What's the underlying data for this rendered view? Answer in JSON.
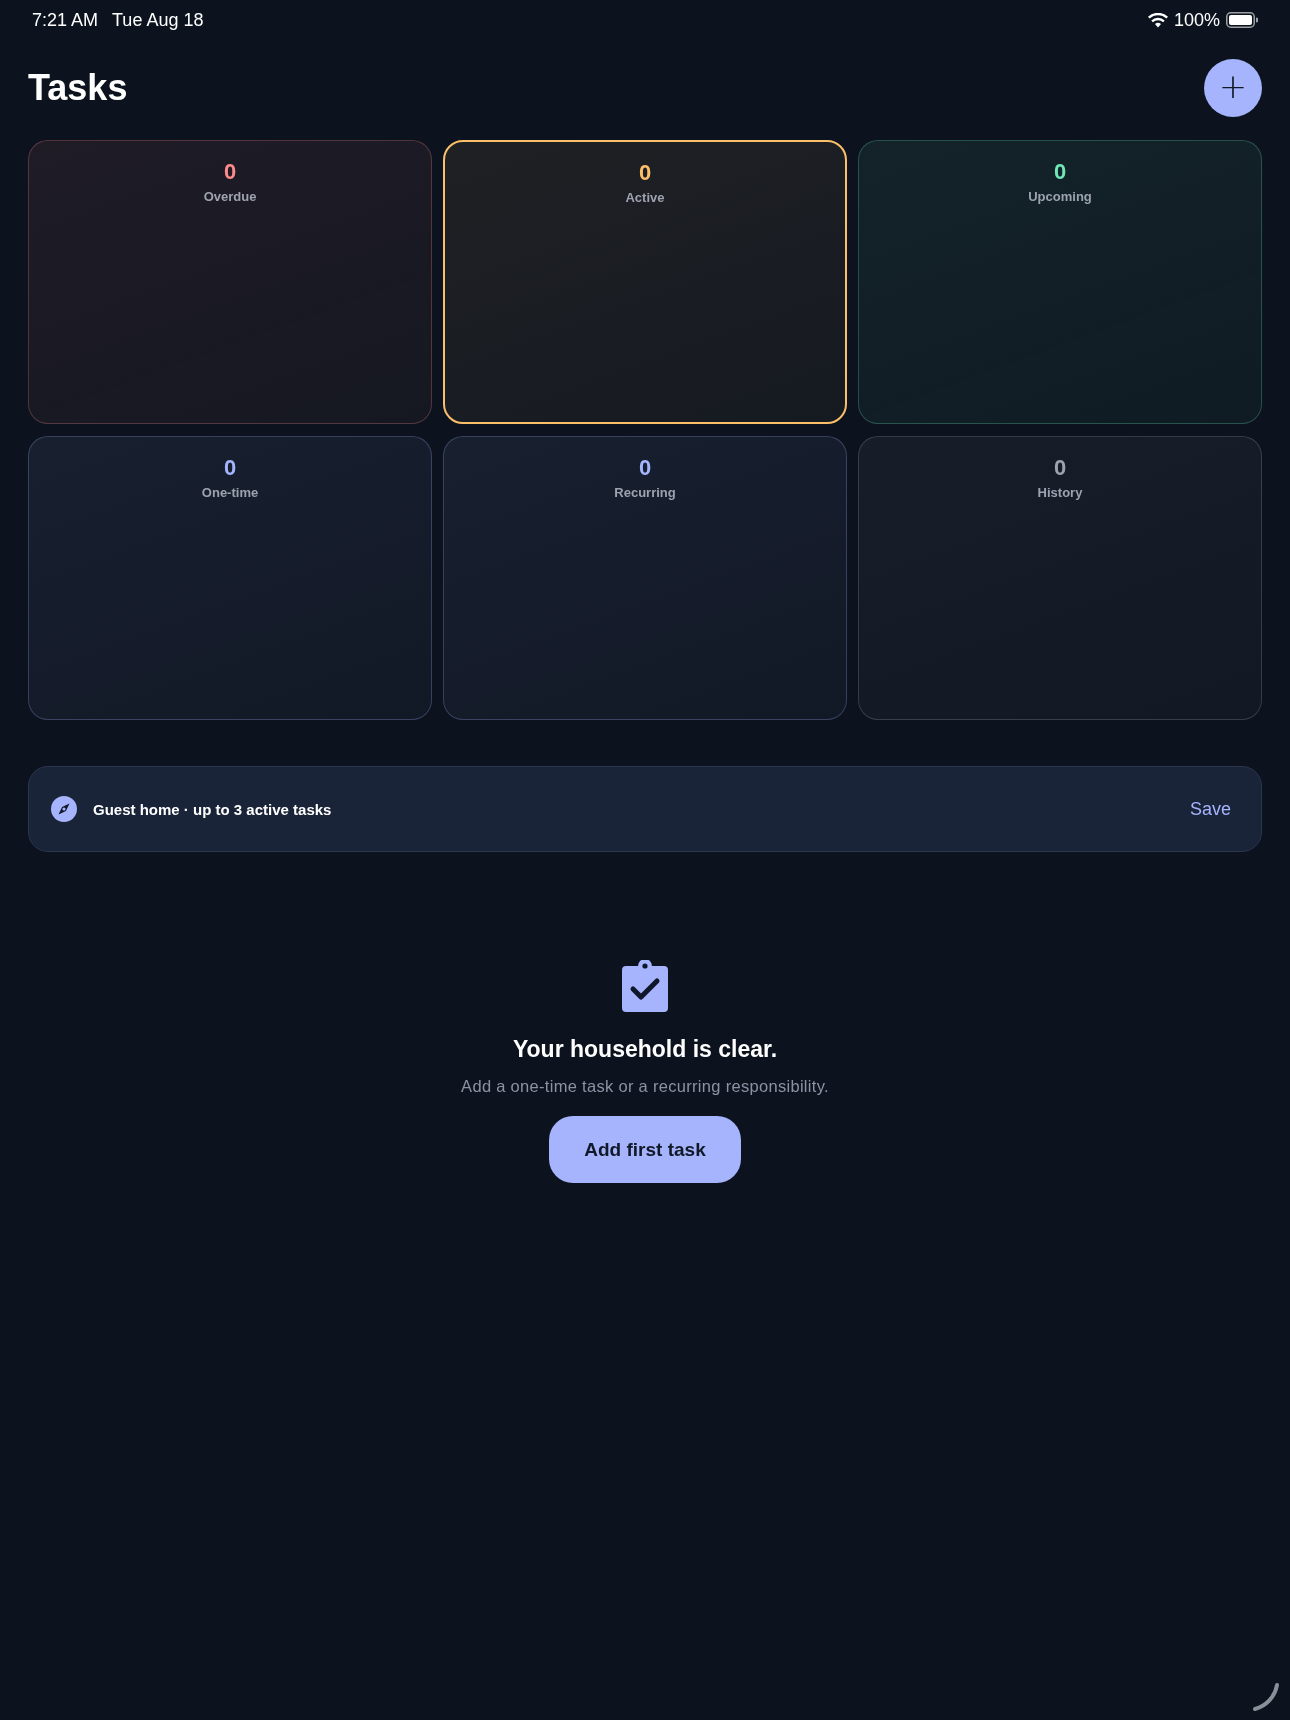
{
  "status_bar": {
    "time": "7:21 AM",
    "date": "Tue Aug 18",
    "battery": "100%"
  },
  "header": {
    "title": "Tasks",
    "add_button": "+"
  },
  "cards": [
    {
      "count": "0",
      "label": "Overdue",
      "color": "#ff8a8a",
      "selected": false
    },
    {
      "count": "0",
      "label": "Active",
      "color": "#fbbf6a",
      "selected": true
    },
    {
      "count": "0",
      "label": "Upcoming",
      "color": "#6ee7b7",
      "selected": false
    },
    {
      "count": "0",
      "label": "One-time",
      "color": "#a5b4fc",
      "selected": false
    },
    {
      "count": "0",
      "label": "Recurring",
      "color": "#a5b4fc",
      "selected": false
    },
    {
      "count": "0",
      "label": "History",
      "color": "#9ca3af",
      "selected": false
    }
  ],
  "banner": {
    "text": "Guest home · up to 3 active tasks",
    "action": "Save"
  },
  "empty_state": {
    "title": "Your household is clear.",
    "subtitle": "Add a one-time task or a recurring responsibility.",
    "button": "Add first task"
  }
}
